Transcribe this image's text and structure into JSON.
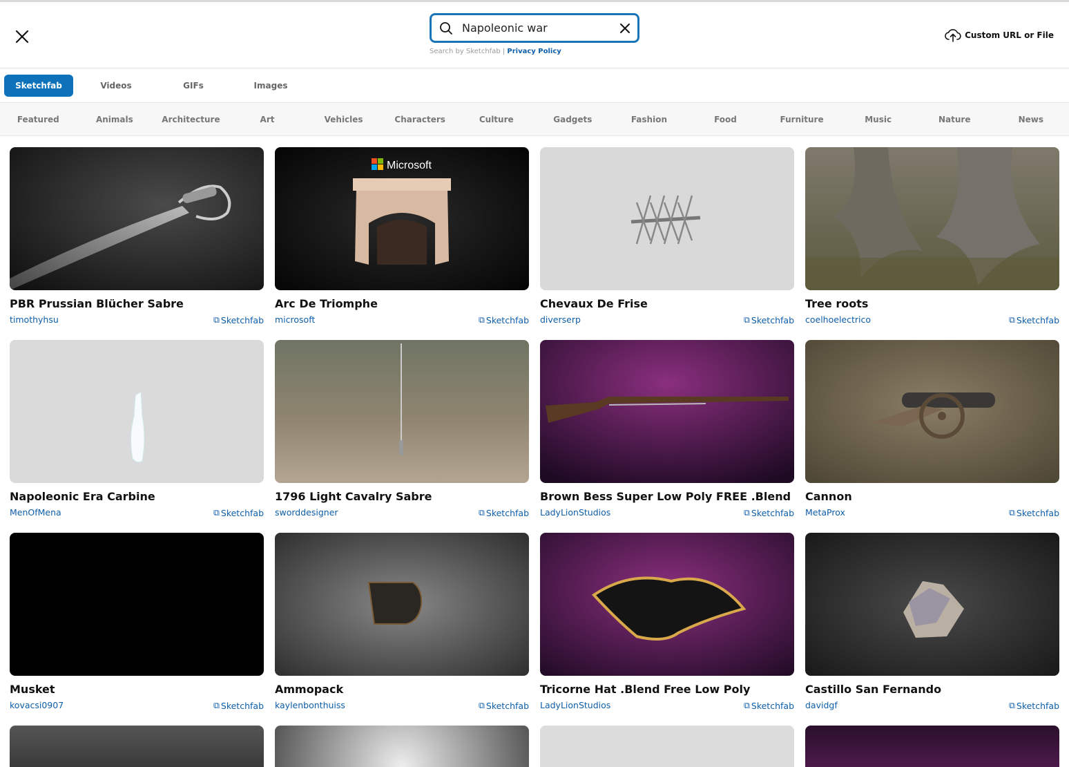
{
  "search": {
    "value": "Napoleonic war",
    "note": "Search by Sketchfab |",
    "privacy_link": "Privacy Policy"
  },
  "header": {
    "custom_url_label": "Custom URL or File"
  },
  "tabs": [
    {
      "label": "Sketchfab",
      "active": true
    },
    {
      "label": "Videos",
      "active": false
    },
    {
      "label": "GIFs",
      "active": false
    },
    {
      "label": "Images",
      "active": false
    }
  ],
  "categories": [
    "Featured",
    "Animals",
    "Architecture",
    "Art",
    "Vehicles",
    "Characters",
    "Culture",
    "Gadgets",
    "Fashion",
    "Food",
    "Furniture",
    "Music",
    "Nature",
    "News"
  ],
  "results": [
    {
      "title": "PBR Prussian Blücher Sabre",
      "author": "timothyhsu",
      "source": "Sketchfab"
    },
    {
      "title": "Arc De Triomphe",
      "author": "microsoft",
      "source": "Sketchfab",
      "logo_text": "Microsoft"
    },
    {
      "title": "Chevaux De Frise",
      "author": "diverserp",
      "source": "Sketchfab"
    },
    {
      "title": "Tree roots",
      "author": "coelhoelectrico",
      "source": "Sketchfab"
    },
    {
      "title": "Napoleonic Era Carbine",
      "author": "MenOfMena",
      "source": "Sketchfab"
    },
    {
      "title": "1796 Light Cavalry Sabre",
      "author": "sworddesigner",
      "source": "Sketchfab"
    },
    {
      "title": "Brown Bess Super Low Poly FREE .Blend",
      "author": "LadyLionStudios",
      "source": "Sketchfab"
    },
    {
      "title": "Cannon",
      "author": "MetaProx",
      "source": "Sketchfab"
    },
    {
      "title": "Musket",
      "author": "kovacsi0907",
      "source": "Sketchfab"
    },
    {
      "title": "Ammopack",
      "author": "kaylenbonthuiss",
      "source": "Sketchfab"
    },
    {
      "title": "Tricorne Hat .Blend Free Low Poly",
      "author": "LadyLionStudios",
      "source": "Sketchfab"
    },
    {
      "title": "Castillo San Fernando",
      "author": "davidgf",
      "source": "Sketchfab"
    }
  ],
  "colors": {
    "accent": "#0d72b9",
    "link": "#0d5ea8"
  }
}
